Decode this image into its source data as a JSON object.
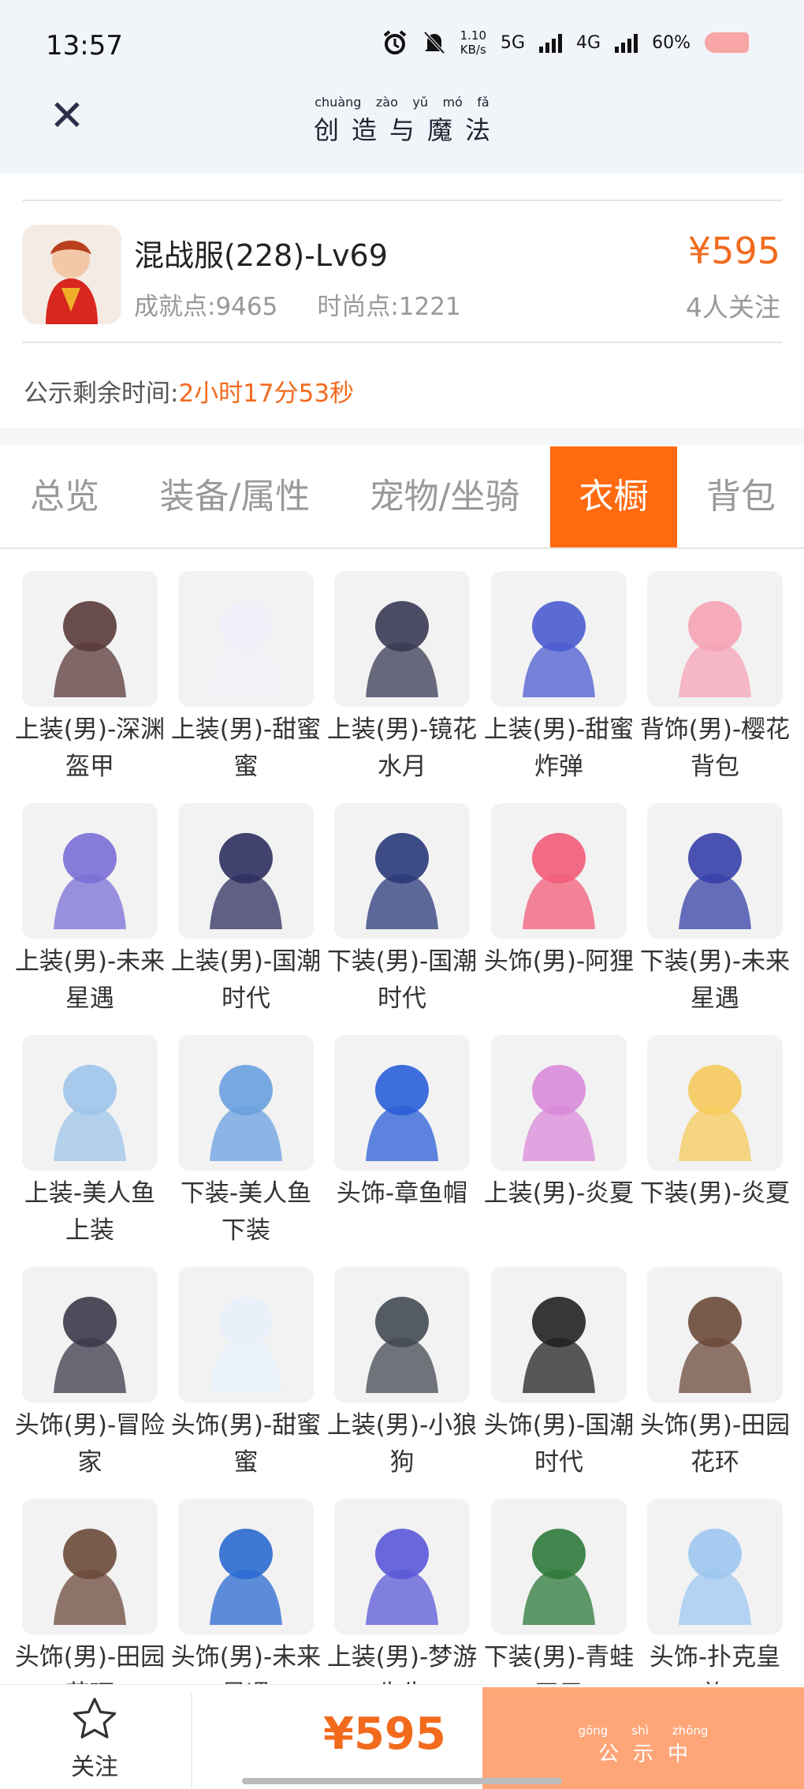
{
  "status": {
    "time": "13:57",
    "speed": "1.10",
    "speed_unit": "KB/s",
    "net1": "5G",
    "net2": "4G",
    "battery": "60%"
  },
  "header": {
    "title_pinyin": [
      "chuàng",
      "zào",
      "yǔ",
      "mó",
      "fǎ"
    ],
    "title_chars": [
      "创",
      "造",
      "与",
      "魔",
      "法"
    ]
  },
  "item": {
    "name": "混战服(228)-Lv69",
    "achievement": "成就点:9465",
    "fashion": "时尚点:1221",
    "price": "¥595",
    "followers": "4人关注"
  },
  "notice": {
    "label": "公示剩余时间:",
    "value": "2小时17分53秒"
  },
  "tabs": [
    {
      "label": "总览"
    },
    {
      "label": "装备/属性"
    },
    {
      "label": "宠物/坐骑"
    },
    {
      "label": "衣橱"
    },
    {
      "label": "背包"
    }
  ],
  "active_tab": "衣橱",
  "wardrobe": [
    "上装(男)-深渊盔甲",
    "上装(男)-甜蜜蜜",
    "上装(男)-镜花水月",
    "上装(男)-甜蜜炸弹",
    "背饰(男)-樱花背包",
    "上装(男)-未来星遇",
    "上装(男)-国潮时代",
    "下装(男)-国潮时代",
    "头饰(男)-阿狸",
    "下装(男)-未来星遇",
    "上装-美人鱼上装",
    "下装-美人鱼下装",
    "头饰-章鱼帽",
    "上装(男)-炎夏",
    "下装(男)-炎夏",
    "头饰(男)-冒险家",
    "头饰(男)-甜蜜蜜",
    "上装(男)-小狼狗",
    "头饰(男)-国潮时代",
    "头饰(男)-田园花环",
    "头饰(男)-田园花环",
    "头饰(男)-未来星遇",
    "上装(男)-梦游先生",
    "下装(男)-青蛙王子",
    "头饰-扑克皇族"
  ],
  "thumb_colors": [
    "#5a3a3a",
    "#f0f0f8",
    "#3a3a55",
    "#4b5bd0",
    "#f6a3b5",
    "#7b6fd6",
    "#2d2f5e",
    "#2a3a7a",
    "#f25c78",
    "#3640a8",
    "#9ec4ea",
    "#6aa0e0",
    "#2a5fd8",
    "#d98ad9",
    "#f5c95c",
    "#3a3a4a",
    "#e8f0fa",
    "#444a52",
    "#222",
    "#6c4a3a",
    "#6c4a3a",
    "#2a6ad0",
    "#5a58d8",
    "#2e7a3a",
    "#9fc7f0"
  ],
  "bottom": {
    "follow_label": "关注",
    "price": "¥595",
    "public_pinyin": [
      "gōng",
      "shì",
      "zhōng"
    ],
    "public_chars": [
      "公",
      "示",
      "中"
    ]
  }
}
